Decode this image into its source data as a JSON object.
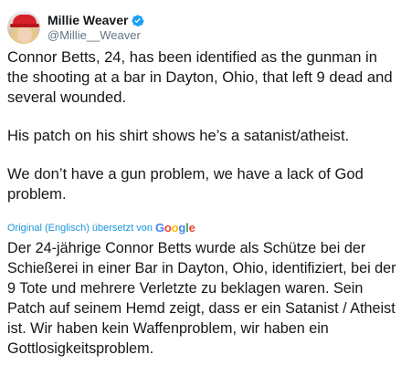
{
  "author": {
    "display_name": "Millie Weaver",
    "handle": "@Millie__Weaver"
  },
  "tweet": {
    "paragraph_1": "Connor Betts, 24, has been identified as the gunman in the shooting at a bar in Dayton, Ohio, that left 9 dead and several wounded.",
    "paragraph_2": "His patch on his shirt shows he’s a satanist/atheist.",
    "paragraph_3": "We don’t have a gun problem, we have a lack of God problem."
  },
  "translation_bar": {
    "label": "Original (Englisch) übersetzt von",
    "provider": [
      "G",
      "o",
      "o",
      "g",
      "l",
      "e"
    ],
    "provider_colors": [
      "#4285f4",
      "#ea4335",
      "#fbbc05",
      "#4285f4",
      "#34a853",
      "#ea4335"
    ]
  },
  "translation": {
    "text": "Der 24-jährige Connor Betts wurde als Schütze bei der Schießerei in einer Bar in Dayton, Ohio, identifiziert, bei der 9 Tote und mehrere Verletzte zu beklagen waren. Sein Patch auf seinem Hemd zeigt, dass er ein Satanist / Atheist ist. Wir haben kein Waffenproblem, wir haben ein Gottlosigkeitsproblem."
  },
  "colors": {
    "verified": "#1da1f2",
    "link": "#1b95e0",
    "secondary_text": "#657786"
  }
}
